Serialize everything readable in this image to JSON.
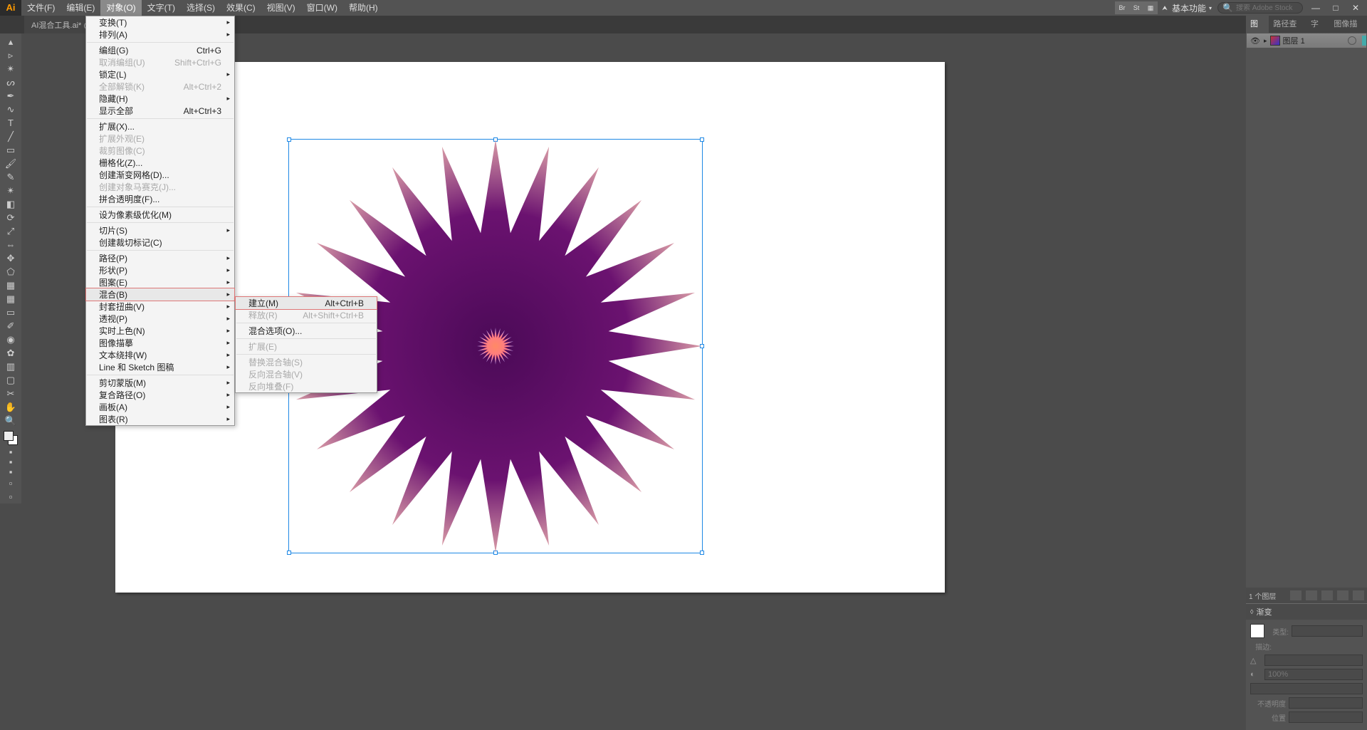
{
  "app": {
    "logo": "Ai",
    "workspace_label": "基本功能",
    "search_placeholder": "搜索 Adobe Stock"
  },
  "menubar": {
    "items": [
      {
        "label": "文件(F)"
      },
      {
        "label": "编辑(E)"
      },
      {
        "label": "对象(O)",
        "active": true
      },
      {
        "label": "文字(T)"
      },
      {
        "label": "选择(S)"
      },
      {
        "label": "效果(C)"
      },
      {
        "label": "视图(V)"
      },
      {
        "label": "窗口(W)"
      },
      {
        "label": "帮助(H)"
      }
    ]
  },
  "document_tab": "AI混合工具.ai* @",
  "dropdown_object": {
    "items": [
      {
        "label": "变换(T)",
        "sub": true
      },
      {
        "label": "排列(A)",
        "sub": true
      },
      {
        "sep": true
      },
      {
        "label": "编组(G)",
        "shortcut": "Ctrl+G"
      },
      {
        "label": "取消编组(U)",
        "shortcut": "Shift+Ctrl+G",
        "disabled": true
      },
      {
        "label": "锁定(L)",
        "sub": true
      },
      {
        "label": "全部解锁(K)",
        "shortcut": "Alt+Ctrl+2",
        "disabled": true
      },
      {
        "label": "隐藏(H)",
        "sub": true
      },
      {
        "label": "显示全部",
        "shortcut": "Alt+Ctrl+3"
      },
      {
        "sep": true
      },
      {
        "label": "扩展(X)..."
      },
      {
        "label": "扩展外观(E)",
        "disabled": true
      },
      {
        "label": "裁剪图像(C)",
        "disabled": true
      },
      {
        "label": "栅格化(Z)..."
      },
      {
        "label": "创建渐变网格(D)..."
      },
      {
        "label": "创建对象马赛克(J)...",
        "disabled": true
      },
      {
        "label": "拼合透明度(F)..."
      },
      {
        "sep": true
      },
      {
        "label": "设为像素级优化(M)"
      },
      {
        "sep": true
      },
      {
        "label": "切片(S)",
        "sub": true
      },
      {
        "label": "创建裁切标记(C)"
      },
      {
        "sep": true
      },
      {
        "label": "路径(P)",
        "sub": true
      },
      {
        "label": "形状(P)",
        "sub": true
      },
      {
        "label": "图案(E)",
        "sub": true
      },
      {
        "label": "混合(B)",
        "sub": true,
        "hovered": true
      },
      {
        "label": "封套扭曲(V)",
        "sub": true
      },
      {
        "label": "透视(P)",
        "sub": true
      },
      {
        "label": "实时上色(N)",
        "sub": true
      },
      {
        "label": "图像描摹",
        "sub": true
      },
      {
        "label": "文本绕排(W)",
        "sub": true
      },
      {
        "label": "Line 和 Sketch 图稿",
        "sub": true
      },
      {
        "sep": true
      },
      {
        "label": "剪切蒙版(M)",
        "sub": true
      },
      {
        "label": "复合路径(O)",
        "sub": true
      },
      {
        "label": "画板(A)",
        "sub": true
      },
      {
        "label": "图表(R)",
        "sub": true
      }
    ]
  },
  "submenu_blend": {
    "items": [
      {
        "label": "建立(M)",
        "shortcut": "Alt+Ctrl+B",
        "hovered": true
      },
      {
        "label": "释放(R)",
        "shortcut": "Alt+Shift+Ctrl+B",
        "disabled": true
      },
      {
        "sep": true
      },
      {
        "label": "混合选项(O)..."
      },
      {
        "sep": true
      },
      {
        "label": "扩展(E)",
        "disabled": true
      },
      {
        "sep": true
      },
      {
        "label": "替换混合轴(S)",
        "disabled": true
      },
      {
        "label": "反向混合轴(V)",
        "disabled": true
      },
      {
        "label": "反向堆叠(F)",
        "disabled": true
      }
    ]
  },
  "tools": [
    "select",
    "direct",
    "wand",
    "lasso",
    "pen",
    "curvature",
    "type",
    "line",
    "rect",
    "brush",
    "pencil",
    "shaper",
    "eraser",
    "rotate",
    "scale",
    "width",
    "free",
    "shape-builder",
    "perspective",
    "mesh",
    "gradient",
    "eyedropper",
    "blend",
    "symbol",
    "column",
    "artboard",
    "slice",
    "hand",
    "zoom"
  ],
  "panels": {
    "tabs": [
      {
        "label": "图层",
        "active": true
      },
      {
        "label": "路径查找",
        "active": false
      },
      {
        "label": "字符",
        "active": false
      },
      {
        "label": "图像描摹",
        "active": false
      }
    ],
    "layer": {
      "name": "图层 1"
    },
    "footer_count": "1 个图层",
    "gradient": {
      "title": "渐变",
      "type_label": "类型:",
      "stroke_label": "描边:",
      "angle_label": "角度",
      "aspect_label": "100%",
      "opacity_label": "不透明度",
      "position_label": "位置"
    }
  }
}
